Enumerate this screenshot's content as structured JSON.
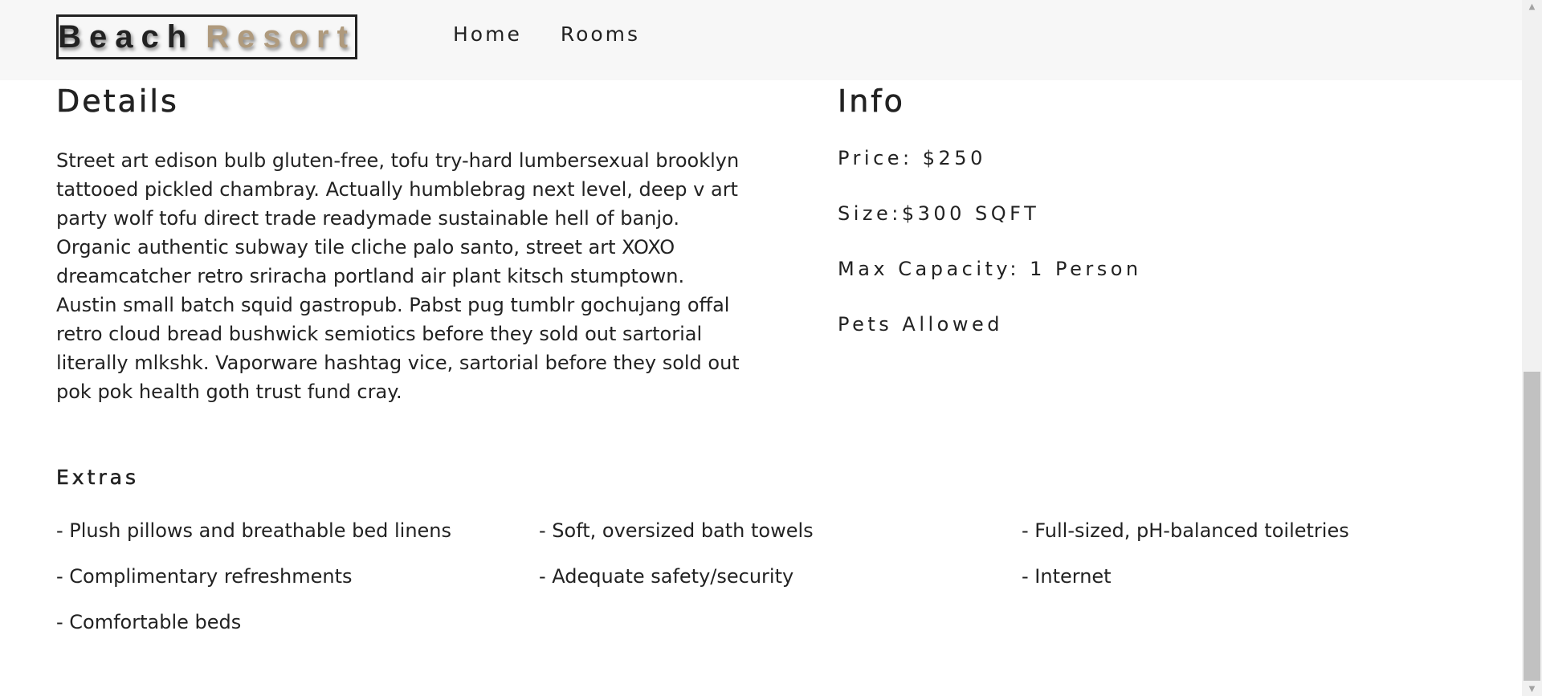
{
  "navbar": {
    "logo": {
      "word1": "Beach",
      "word2": "Resort"
    },
    "links": [
      {
        "label": "Home"
      },
      {
        "label": "Rooms"
      }
    ]
  },
  "details": {
    "title": "Details",
    "description": "Street art edison bulb gluten-free, tofu try-hard lumbersexual brooklyn tattooed pickled chambray. Actually humblebrag next level, deep v art party wolf tofu direct trade readymade sustainable hell of banjo. Organic authentic subway tile cliche palo santo, street art XOXO dreamcatcher retro sriracha portland air plant kitsch stumptown. Austin small batch squid gastropub. Pabst pug tumblr gochujang offal retro cloud bread bushwick semiotics before they sold out sartorial literally mlkshk. Vaporware hashtag vice, sartorial before they sold out pok pok health goth trust fund cray."
  },
  "info": {
    "title": "Info",
    "price": "Price: $250",
    "size": "Size:$300 SQFT",
    "capacity": "Max Capacity: 1 Person",
    "pets": "Pets Allowed"
  },
  "extras": {
    "title": "Extras",
    "items": [
      "- Plush pillows and breathable bed linens",
      "- Soft, oversized bath towels",
      "- Full-sized, pH-balanced toiletries",
      "- Complimentary refreshments",
      "- Adequate safety/security",
      "- Internet",
      "- Comfortable beds"
    ]
  },
  "colors": {
    "logo_accent": "#af9a7d",
    "text": "#222222",
    "navbar_bg": "#f7f7f7"
  }
}
